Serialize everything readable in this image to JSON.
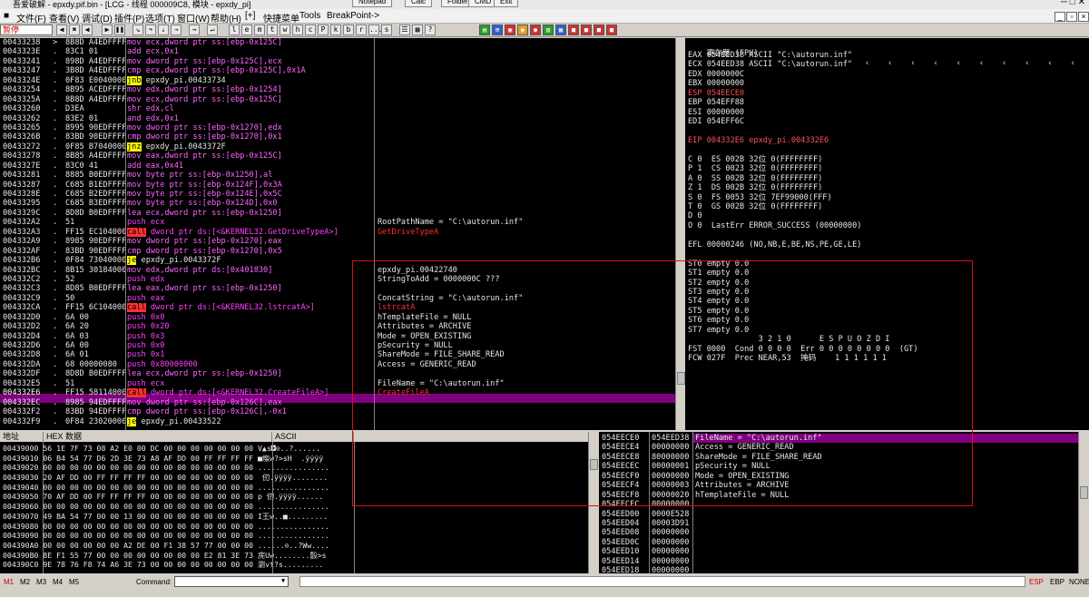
{
  "window": {
    "title": "吾爱破解 - epxdy.pif.bin - [LCG - 线程 000009C8, 模块 - epxdy_pi]",
    "top_buttons": [
      "Notepad",
      "Calc",
      "Folder",
      "CMD",
      "Exit"
    ]
  },
  "menu": {
    "items": [
      "文件(F)",
      "查看(V)",
      "调试(D)",
      "插件(P)",
      "选项(T)",
      "窗口(W)",
      "帮助(H)",
      "[+]",
      "快捷菜单",
      "Tools",
      "BreakPoint->"
    ]
  },
  "toolbar": {
    "status": "暂停",
    "letters": [
      "l",
      "e",
      "m",
      "t",
      "w",
      "h",
      "c",
      "P",
      "k",
      "b",
      "r",
      "...",
      "s"
    ]
  },
  "cpu": {
    "addresses": [
      "00433238",
      "0043323E",
      "00433241",
      "00433247",
      "0043324E",
      "00433254",
      "0043325A",
      "00433260",
      "00433262",
      "00433265",
      "0043326B",
      "00433272",
      "00433278",
      "0043327E",
      "00433281",
      "00433287",
      "0043328E",
      "00433295",
      "0043329C",
      "004332A2",
      "004332A3",
      "004332A9",
      "004332AF",
      "004332B6",
      "004332BC",
      "004332C2",
      "004332C3",
      "004332C9",
      "004332CA",
      "004332D0",
      "004332D2",
      "004332D4",
      "004332D6",
      "004332D8",
      "004332DA",
      "004332DF",
      "004332E5",
      "004332E6",
      "004332EC",
      "004332F2",
      "004332F9"
    ],
    "marks": [
      ">",
      ".",
      ".",
      ".",
      ".",
      ".",
      ".",
      ".",
      ".",
      ".",
      ".",
      ".",
      ".",
      ".",
      ".",
      ".",
      ".",
      ".",
      ".",
      ".",
      ".",
      ".",
      ".",
      ".",
      ".",
      ".",
      ".",
      ".",
      ".",
      ".",
      ".",
      ".",
      ".",
      ".",
      ".",
      ".",
      ".",
      ".",
      ".",
      ".",
      "."
    ],
    "hex": [
      "8B8D A4EDFFFF",
      "83C1 01",
      "898D A4EDFFFF",
      "3B8D A4EDFFFF",
      "0F83 E0040000",
      "8B95 ACEDFFFF",
      "8B8D A4EDFFFF",
      "D3EA",
      "83E2 01",
      "8995 90EDFFFF",
      "83BD 90EDFFFF",
      "0F85 B7040000",
      "8B85 A4EDFFFF",
      "83C0 41",
      "8885 B0EDFFFF",
      "C685 B1EDFFFF",
      "C685 B2EDFFFF",
      "C685 B3EDFFFF",
      "8D8D B0EDFFFF",
      "51",
      "FF15 EC104000",
      "8985 90EDFFFF",
      "83BD 90EDFFFF",
      "0F84 73040000",
      "8B15 30184000",
      "52",
      "8D85 B0EDFFFF",
      "50",
      "FF15 6C104000",
      "6A 00",
      "6A 20",
      "6A 03",
      "6A 00",
      "6A 01",
      "68 00000080",
      "8D8D B0EDFFFF",
      "51",
      "FF15 58114000",
      "8985 94EDFFFF",
      "83BD 94EDFFFF",
      "0F84 23020000"
    ],
    "asm": [
      [
        "mov",
        "ecx,dword ptr ss:[ebp-0x125C]"
      ],
      [
        "add",
        "ecx,0x1"
      ],
      [
        "mov",
        "dword ptr ss:[ebp-0x125C],ecx"
      ],
      [
        "cmp",
        "ecx,dword ptr ss:[ebp-0x125C],0x1A"
      ],
      [
        "jnb",
        "epxdy_pi.00433734"
      ],
      [
        "mov",
        "edx,dword ptr ss:[ebp-0x1254]"
      ],
      [
        "mov",
        "ecx,dword ptr ss:[ebp-0x125C]"
      ],
      [
        "shr",
        "edx,cl"
      ],
      [
        "and",
        "edx,0x1"
      ],
      [
        "mov",
        "dword ptr ss:[ebp-0x1270],edx"
      ],
      [
        "cmp",
        "dword ptr ss:[ebp-0x1270],0x1"
      ],
      [
        "jnz",
        "epxdy_pi.0043372F"
      ],
      [
        "mov",
        "eax,dword ptr ss:[ebp-0x125C]"
      ],
      [
        "add",
        "eax,0x41"
      ],
      [
        "mov",
        "byte ptr ss:[ebp-0x1250],al"
      ],
      [
        "mov",
        "byte ptr ss:[ebp-0x124F],0x3A"
      ],
      [
        "mov",
        "byte ptr ss:[ebp-0x124E],0x5C"
      ],
      [
        "mov",
        "byte ptr ss:[ebp-0x124D],0x0"
      ],
      [
        "lea",
        "ecx,dword ptr ss:[ebp-0x1250]"
      ],
      [
        "push",
        "ecx"
      ],
      [
        "call",
        "dword ptr ds:[<&KERNEL32.GetDriveTypeA>]"
      ],
      [
        "mov",
        "dword ptr ss:[ebp-0x1270],eax"
      ],
      [
        "cmp",
        "dword ptr ss:[ebp-0x1270],0x5"
      ],
      [
        "je",
        "epxdy_pi.0043372F"
      ],
      [
        "mov",
        "edx,dword ptr ds:[0x401830]"
      ],
      [
        "push",
        "edx"
      ],
      [
        "lea",
        "eax,dword ptr ss:[ebp-0x1250]"
      ],
      [
        "push",
        "eax"
      ],
      [
        "call",
        "dword ptr ds:[<&KERNEL32.lstrcatA>]"
      ],
      [
        "push",
        "0x0"
      ],
      [
        "push",
        "0x20"
      ],
      [
        "push",
        "0x3"
      ],
      [
        "push",
        "0x0"
      ],
      [
        "push",
        "0x1"
      ],
      [
        "push",
        "0x80000000"
      ],
      [
        "lea",
        "ecx,dword ptr ss:[ebp-0x1250]"
      ],
      [
        "push",
        "ecx"
      ],
      [
        "call",
        "dword ptr ds:[<&KERNEL32.CreateFileA>]"
      ],
      [
        "mov",
        "dword ptr ss:[ebp-0x126C],eax"
      ],
      [
        "cmp",
        "dword ptr ss:[ebp-0x126C],-0x1"
      ],
      [
        "je",
        "epxdy_pi.00433522"
      ]
    ],
    "comments": [
      "",
      "",
      "",
      "",
      "",
      "",
      "",
      "",
      "",
      "",
      "",
      "",
      "",
      "",
      "",
      "",
      "",
      "",
      "",
      "RootPathName = \"C:\\autorun.inf\"",
      "GetDriveTypeA",
      "",
      "",
      "",
      "epxdy_pi.00422740",
      "StringToAdd = 0000000C ???",
      "",
      "ConcatString = \"C:\\autorun.inf\"",
      "lstrcatA",
      "hTemplateFile = NULL",
      "Attributes = ARCHIVE",
      "Mode = OPEN_EXISTING",
      "pSecurity = NULL",
      "ShareMode = FILE_SHARE_READ",
      "Access = GENERIC_READ",
      "",
      "FileName = \"C:\\autorun.inf\"",
      "CreateFileA",
      "",
      "",
      ""
    ]
  },
  "registers": {
    "header": "寄存器 (FPU)",
    "lines": [
      "EAX 054EED38 ASCII \"C:\\autorun.inf\"",
      "ECX 054EED38 ASCII \"C:\\autorun.inf\"",
      "EDX 0000000C",
      "EBX 00000000",
      "ESP 054EECE0",
      "EBP 054EFF88",
      "ESI 00000000",
      "EDI 054EFF6C",
      "",
      "EIP 004332E6 epxdy_pi.004332E6",
      "",
      "C 0  ES 002B 32位 0(FFFFFFFF)",
      "P 1  CS 0023 32位 0(FFFFFFFF)",
      "A 0  SS 002B 32位 0(FFFFFFFF)",
      "Z 1  DS 002B 32位 0(FFFFFFFF)",
      "S 0  FS 0053 32位 7EF99000(FFF)",
      "T 0  GS 002B 32位 0(FFFFFFFF)",
      "D 0",
      "O 0  LastErr ERROR_SUCCESS (00000000)",
      "",
      "EFL 00000246 (NO,NB,E,BE,NS,PE,GE,LE)",
      "",
      "ST0 empty 0.0",
      "ST1 empty 0.0",
      "ST2 empty 0.0",
      "ST3 empty 0.0",
      "ST4 empty 0.0",
      "ST5 empty 0.0",
      "ST6 empty 0.0",
      "ST7 empty 0.0",
      "               3 2 1 0      E S P U O Z D I",
      "FST 0000  Cond 0 0 0 0  Err 0 0 0 0 0 0 0 0  (GT)",
      "FCW 027F  Prec NEAR,53  掩码    1 1 1 1 1 1"
    ]
  },
  "dump": {
    "headers": [
      "地址",
      "HEX 数据",
      "ASCII"
    ],
    "rows": [
      [
        "00439000",
        "56 1E 7F 73 08 A2 E0 00 DC 00 00 00 00 00 00 00",
        "V▲s◘⊙..?......"
      ],
      [
        "00439010",
        "06 B4 54 77 D6 2D 3E 73 A8 AF DD 00 FF FF FF FF",
        "■瘬w?>sH  .ÿÿÿÿ"
      ],
      [
        "00439020",
        "00 00 00 00 00 00 00 00 00 00 00 00 00 00 00 00",
        "................"
      ],
      [
        "00439030",
        "20 AF DD 00 FF FF FF FF 00 00 00 00 00 00 00 00",
        " 仞.ÿÿÿÿ........"
      ],
      [
        "00439040",
        "00 00 00 00 00 00 00 00 00 00 00 00 00 00 00 00",
        "................"
      ],
      [
        "00439050",
        "70 AF DD 00 FF FF FF FF 00 00 00 00 00 00 00 00",
        "p 仞.ÿÿÿÿ......"
      ],
      [
        "00439060",
        "00 00 00 00 00 00 00 00 00 00 00 00 00 00 00 00",
        "................"
      ],
      [
        "00439070",
        "49 BA 54 77 00 00 13 00 00 00 00 00 00 00 00 00",
        "I王w..■........."
      ],
      [
        "00439080",
        "00 00 00 00 00 00 00 00 00 00 00 00 00 00 00 00",
        "................"
      ],
      [
        "00439090",
        "00 00 00 00 00 00 00 00 00 00 00 00 00 00 00 00",
        "................"
      ],
      [
        "004390A0",
        "00 00 00 00 00 00 A2 DE 00 F1 38 57 77 00 00 00",
        "......⊙..?Ww...."
      ],
      [
        "004390B0",
        "8E F1 55 77 00 00 00 00 00 00 00 00 E2 81 3E 73",
        "庑Uw........瞉>s"
      ],
      [
        "004390C0",
        "9E 78 76 F8 74 A6 3E 73 00 00 00 00 00 00 00 00",
        "瀏vt?s........."
      ]
    ]
  },
  "stack": {
    "addresses": [
      "054EECE0",
      "054EECE4",
      "054EECE8",
      "054EECEC",
      "054EECF0",
      "054EECF4",
      "054EECF8",
      "054EECFC",
      "054EED00",
      "054EED04",
      "054EED08",
      "054EED0C",
      "054EED10",
      "054EED14",
      "054EED18",
      "054EED1C",
      "054EED20"
    ],
    "values": [
      "054EED38",
      "00000000",
      "80000000",
      "00000001",
      "00000000",
      "00000003",
      "00000020",
      "00000000",
      "0000E528",
      "00003D91",
      "00000000",
      "00000000",
      "00000000",
      "00000000",
      "00000000",
      "00000000",
      "00000000"
    ],
    "comments": [
      "FileName = \"C:\\autorun.inf\"",
      "Access = GENERIC_READ",
      "ShareMode = FILE_SHARE_READ",
      "pSecurity = NULL",
      "Mode = OPEN_EXISTING",
      "Attributes = ARCHIVE",
      "hTemplateFile = NULL",
      "",
      "",
      "",
      "",
      "",
      "",
      "",
      "",
      "",
      ""
    ]
  },
  "status": {
    "markers": [
      "M1",
      "M2",
      "M3",
      "M4",
      "M5"
    ],
    "command_label": "Command:",
    "regs_right": [
      "ESP",
      "EBP",
      "NONE"
    ]
  },
  "colors": {
    "highlight_row": "#800080",
    "annotation_box": "#e01010",
    "pause_text": "#cc0000"
  }
}
